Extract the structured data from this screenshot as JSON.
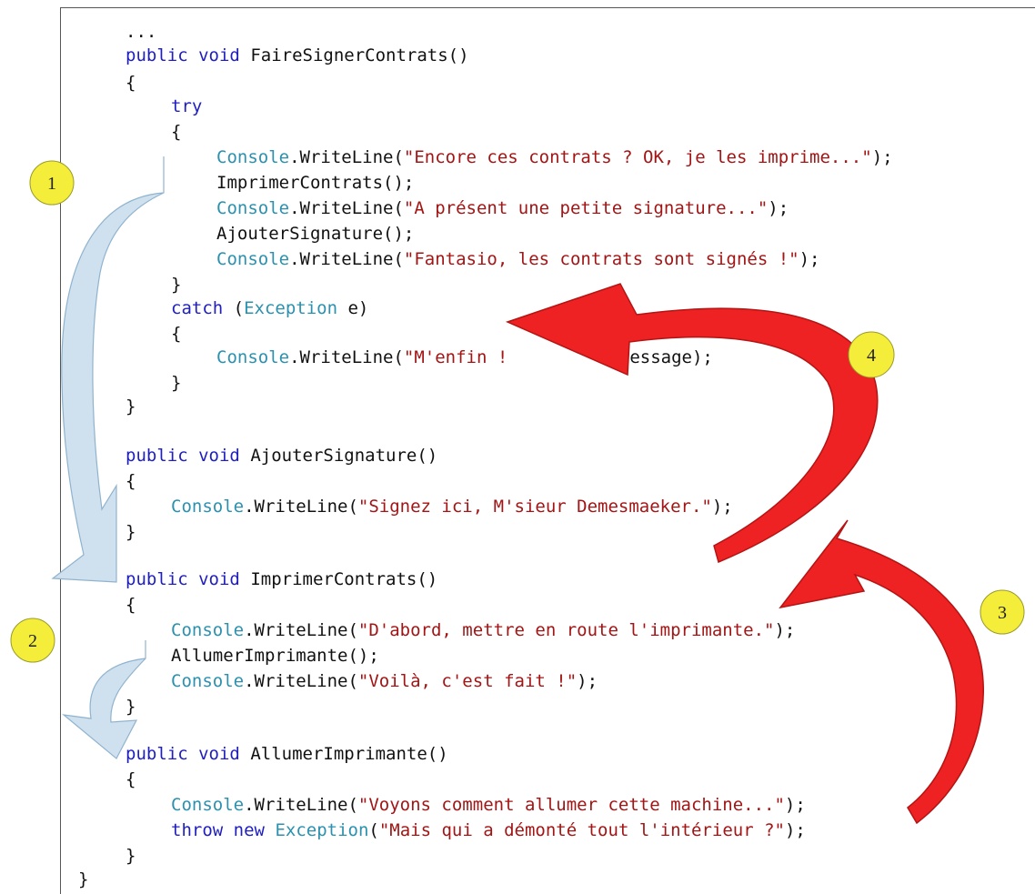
{
  "code": {
    "ellipsis": "...",
    "m1_kw1": "public",
    "m1_kw2": "void",
    "m1_name": "FaireSignerContrats()",
    "open_brace": "{",
    "close_brace": "}",
    "try_kw": "try",
    "console": "Console",
    "writeline_open": ".WriteLine(",
    "close_paren_semi": ");",
    "s1": "\"Encore ces contrats ? OK, je les imprime...\"",
    "call_imprimer": "ImprimerContrats();",
    "s2": "\"A présent une petite signature...\"",
    "call_ajouter": "AjouterSignature();",
    "s3": "\"Fantasio, les contrats sont signés !\"",
    "catch_kw": "catch",
    "catch_open": " (",
    "exception_type": "Exception",
    "catch_rest": " e)",
    "s4": "\"M'enfin !",
    "catch_tail": "e.Message);",
    "m2_name": "AjouterSignature()",
    "s5": "\"Signez ici, M'sieur Demesmaeker.\"",
    "m3_name": "ImprimerContrats()",
    "s6": "\"D'abord, mettre en route l'imprimante.\"",
    "call_allumer": "AllumerImprimante();",
    "s7": "\"Voilà, c'est fait !\"",
    "m4_name": "AllumerImprimante()",
    "s8": "\"Voyons comment allumer cette machine...\"",
    "throw_kw": "throw",
    "new_kw": "new",
    "throw_open": "(",
    "s9": "\"Mais qui a démonté tout l'intérieur ?\""
  },
  "badges": [
    "1",
    "2",
    "3",
    "4"
  ],
  "colors": {
    "keyword": "#1f1fbf",
    "type": "#2b91af",
    "string": "#a31515",
    "flow_arrow": "#cfe0ee",
    "exception_arrow": "#ee2222",
    "badge_fill": "#f4ee3a"
  }
}
